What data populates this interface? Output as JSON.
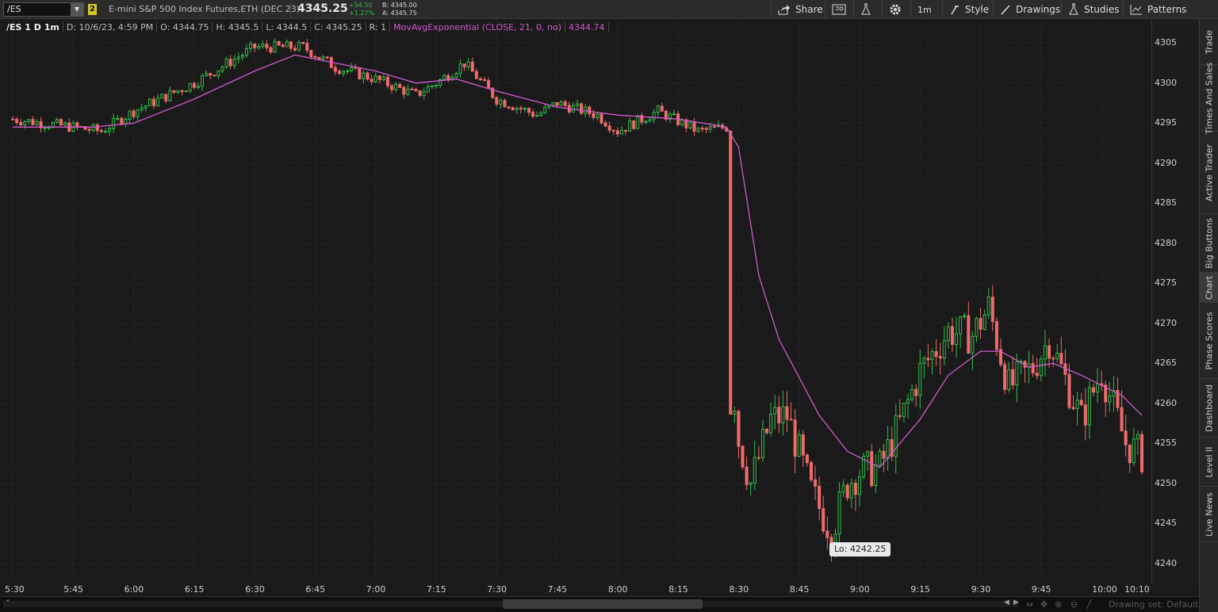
{
  "toolbar": {
    "symbol": "/ES",
    "link_badge": "2",
    "instrument": "E-mini S&P 500 Index Futures,ETH (DEC 23)",
    "last_price": "4345.25",
    "change": "+54.50",
    "change_pct": "+1.27%",
    "bid": "B: 4345.00",
    "ask": "A: 4345.75",
    "share_label": "Share",
    "interval_label": "1m",
    "style_label": "Style",
    "drawings_label": "Drawings",
    "studies_label": "Studies",
    "patterns_label": "Patterns",
    "colors": {
      "up": "#2fbf4a",
      "down": "#f06a6a",
      "ema": "#d05ad0"
    }
  },
  "header": {
    "symbol_tf": "/ES 1 D 1m",
    "date": "D: 10/6/23, 4:59 PM",
    "open": "O: 4344.75",
    "high": "H: 4345.5",
    "low": "L: 4344.5",
    "close": "C: 4345.25",
    "range": "R: 1",
    "study": "MovAvgExponential (CLOSE, 21, 0, no)",
    "study_value": "4344.74"
  },
  "chart_data": {
    "type": "candlestick",
    "x_ticks": [
      "5:30",
      "5:45",
      "6:00",
      "6:15",
      "6:30",
      "6:45",
      "7:00",
      "7:15",
      "7:30",
      "7:45",
      "8:00",
      "8:15",
      "8:30",
      "8:45",
      "9:00",
      "9:15",
      "9:30",
      "9:45",
      "10:00",
      "10:10"
    ],
    "y_ticks": [
      4240,
      4245,
      4250,
      4255,
      4260,
      4265,
      4270,
      4275,
      4280,
      4285,
      4290,
      4295,
      4300,
      4305
    ],
    "ylim": [
      4237.5,
      4308
    ],
    "price_path": [
      [
        "5:30",
        4295.5
      ],
      [
        "5:45",
        4294.5
      ],
      [
        "5:52",
        4294
      ],
      [
        "6:00",
        4296.5
      ],
      [
        "6:15",
        4300
      ],
      [
        "6:30",
        4304.5
      ],
      [
        "6:42",
        4304.5
      ],
      [
        "6:50",
        4302
      ],
      [
        "7:00",
        4300.5
      ],
      [
        "7:10",
        4298.5
      ],
      [
        "7:15",
        4300
      ],
      [
        "7:22",
        4302.5
      ],
      [
        "7:30",
        4298
      ],
      [
        "7:40",
        4296
      ],
      [
        "7:45",
        4297.5
      ],
      [
        "7:55",
        4296
      ],
      [
        "8:00",
        4294
      ],
      [
        "8:10",
        4296.5
      ],
      [
        "8:20",
        4294
      ],
      [
        "8:27",
        4294.5
      ],
      [
        "8:28",
        4259
      ],
      [
        "8:33",
        4250
      ],
      [
        "8:38",
        4258
      ],
      [
        "8:42",
        4258.5
      ],
      [
        "8:48",
        4249
      ],
      [
        "8:53",
        4244
      ],
      [
        "8:57",
        4250
      ],
      [
        "9:00",
        4251.5
      ],
      [
        "9:05",
        4252
      ],
      [
        "9:10",
        4257.5
      ],
      [
        "9:15",
        4264
      ],
      [
        "9:22",
        4269
      ],
      [
        "9:28",
        4268.5
      ],
      [
        "9:32",
        4272
      ],
      [
        "9:37",
        4262
      ],
      [
        "9:43",
        4264.5
      ],
      [
        "9:47",
        4268
      ],
      [
        "9:55",
        4258
      ],
      [
        "10:00",
        4264
      ],
      [
        "10:06",
        4255
      ],
      [
        "10:10",
        4253.5
      ]
    ],
    "ema_path": [
      [
        "5:30",
        4294.5
      ],
      [
        "5:50",
        4294.5
      ],
      [
        "6:00",
        4295
      ],
      [
        "6:15",
        4298
      ],
      [
        "6:30",
        4301.5
      ],
      [
        "6:40",
        4303.5
      ],
      [
        "6:50",
        4302.5
      ],
      [
        "7:00",
        4301.5
      ],
      [
        "7:10",
        4300
      ],
      [
        "7:20",
        4300.5
      ],
      [
        "7:30",
        4299
      ],
      [
        "7:45",
        4297
      ],
      [
        "8:00",
        4296
      ],
      [
        "8:15",
        4295.5
      ],
      [
        "8:27",
        4294.5
      ],
      [
        "8:30",
        4292
      ],
      [
        "8:35",
        4276
      ],
      [
        "8:40",
        4268
      ],
      [
        "8:50",
        4258.5
      ],
      [
        "8:57",
        4254
      ],
      [
        "9:05",
        4252
      ],
      [
        "9:15",
        4258
      ],
      [
        "9:22",
        4263.5
      ],
      [
        "9:30",
        4266.5
      ],
      [
        "9:35",
        4266.5
      ],
      [
        "9:42",
        4264.5
      ],
      [
        "9:48",
        4265
      ],
      [
        "9:55",
        4263.5
      ],
      [
        "10:05",
        4261
      ],
      [
        "10:10",
        4258.5
      ]
    ],
    "low_annotation": {
      "label": "Lo: 4242.25",
      "time": "8:54",
      "value": 4242.25
    },
    "grid": true
  },
  "side_tabs": [
    "Trade",
    "Times And Sales",
    "Active Trader",
    "Big Buttons",
    "Chart",
    "Phase Scores",
    "Dashboard",
    "Level II",
    "Live News"
  ],
  "active_side_tab": "Chart",
  "footer": {
    "drawing_set": "Drawing set: Default"
  }
}
